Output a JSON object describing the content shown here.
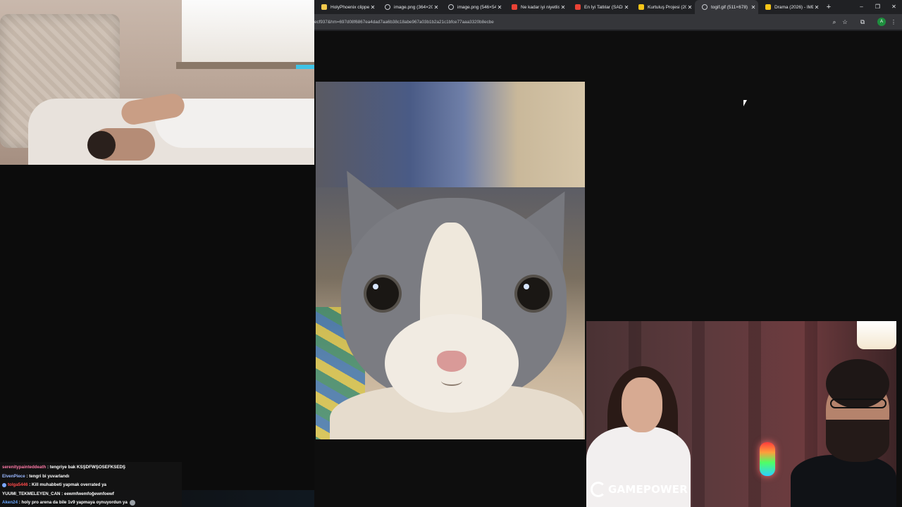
{
  "browser": {
    "tabs": [
      {
        "label": "HolyPhoenix clipper",
        "favicon": "yellow",
        "active": false
      },
      {
        "label": "image.png (364×20",
        "favicon": "globe",
        "active": false
      },
      {
        "label": "image.png (546×54",
        "favicon": "globe",
        "active": false
      },
      {
        "label": "Ne kadar iyi niyetlis",
        "favicon": "red",
        "active": false
      },
      {
        "label": "En İyi Tatlılar (SADE",
        "favicon": "red",
        "active": false
      },
      {
        "label": "Kurtuluş Projesi (20",
        "favicon": "imdb",
        "active": false
      },
      {
        "label": "togif.gif (511×678)",
        "favicon": "globe",
        "active": true
      },
      {
        "label": "Drama (2026) - IMD",
        "favicon": "imdb",
        "active": false
      }
    ],
    "new_tab": "+",
    "window_controls": {
      "minimize": "–",
      "restore": "❐",
      "close": "✕"
    },
    "url": "ecf937&hm=697d08f6867ea4dad7aa6b38c18abe967a03b1b2a21c1bfce77aaa3320b8ecbe",
    "toolbar_icons": {
      "zoom": "⌕",
      "bookmark": "☆",
      "extensions": "⧉",
      "profile": "A",
      "menu": "⋮"
    }
  },
  "overlay": {
    "brand_logo_text": "GAMEPOWER"
  },
  "chat": {
    "messages": [
      {
        "user": "serenitypainteddeath",
        "user_color": "#ff7aa8",
        "badge": false,
        "text": ": tengriye bak KSŞDFWŞOSEFKSEDŞ",
        "emote": false
      },
      {
        "user": "ElvenPiece",
        "user_color": "#9ab8ff",
        "badge": false,
        "text": ": tengri bi yuvarlandı",
        "emote": false
      },
      {
        "user": "tolga5446",
        "user_color": "#ff4a4a",
        "badge": true,
        "text": ": Kill muhabbeti yapmak overrated ya",
        "emote": false
      },
      {
        "user": "YUUMI_TEKMELEYEN_CAN",
        "user_color": "#ffffff",
        "badge": false,
        "text": ": eewmfwemfoğewnfoewf",
        "emote": false
      },
      {
        "user": "Aken24",
        "user_color": "#6aa8ff",
        "badge": false,
        "text": ": holy pro arena da bile 1v9 yapmaya oynuyordun ya",
        "emote": true
      }
    ]
  },
  "colors": {
    "browser_bg": "#202124",
    "toolbar_bg": "#35363a",
    "viewer_bg": "#0e0e0e"
  }
}
